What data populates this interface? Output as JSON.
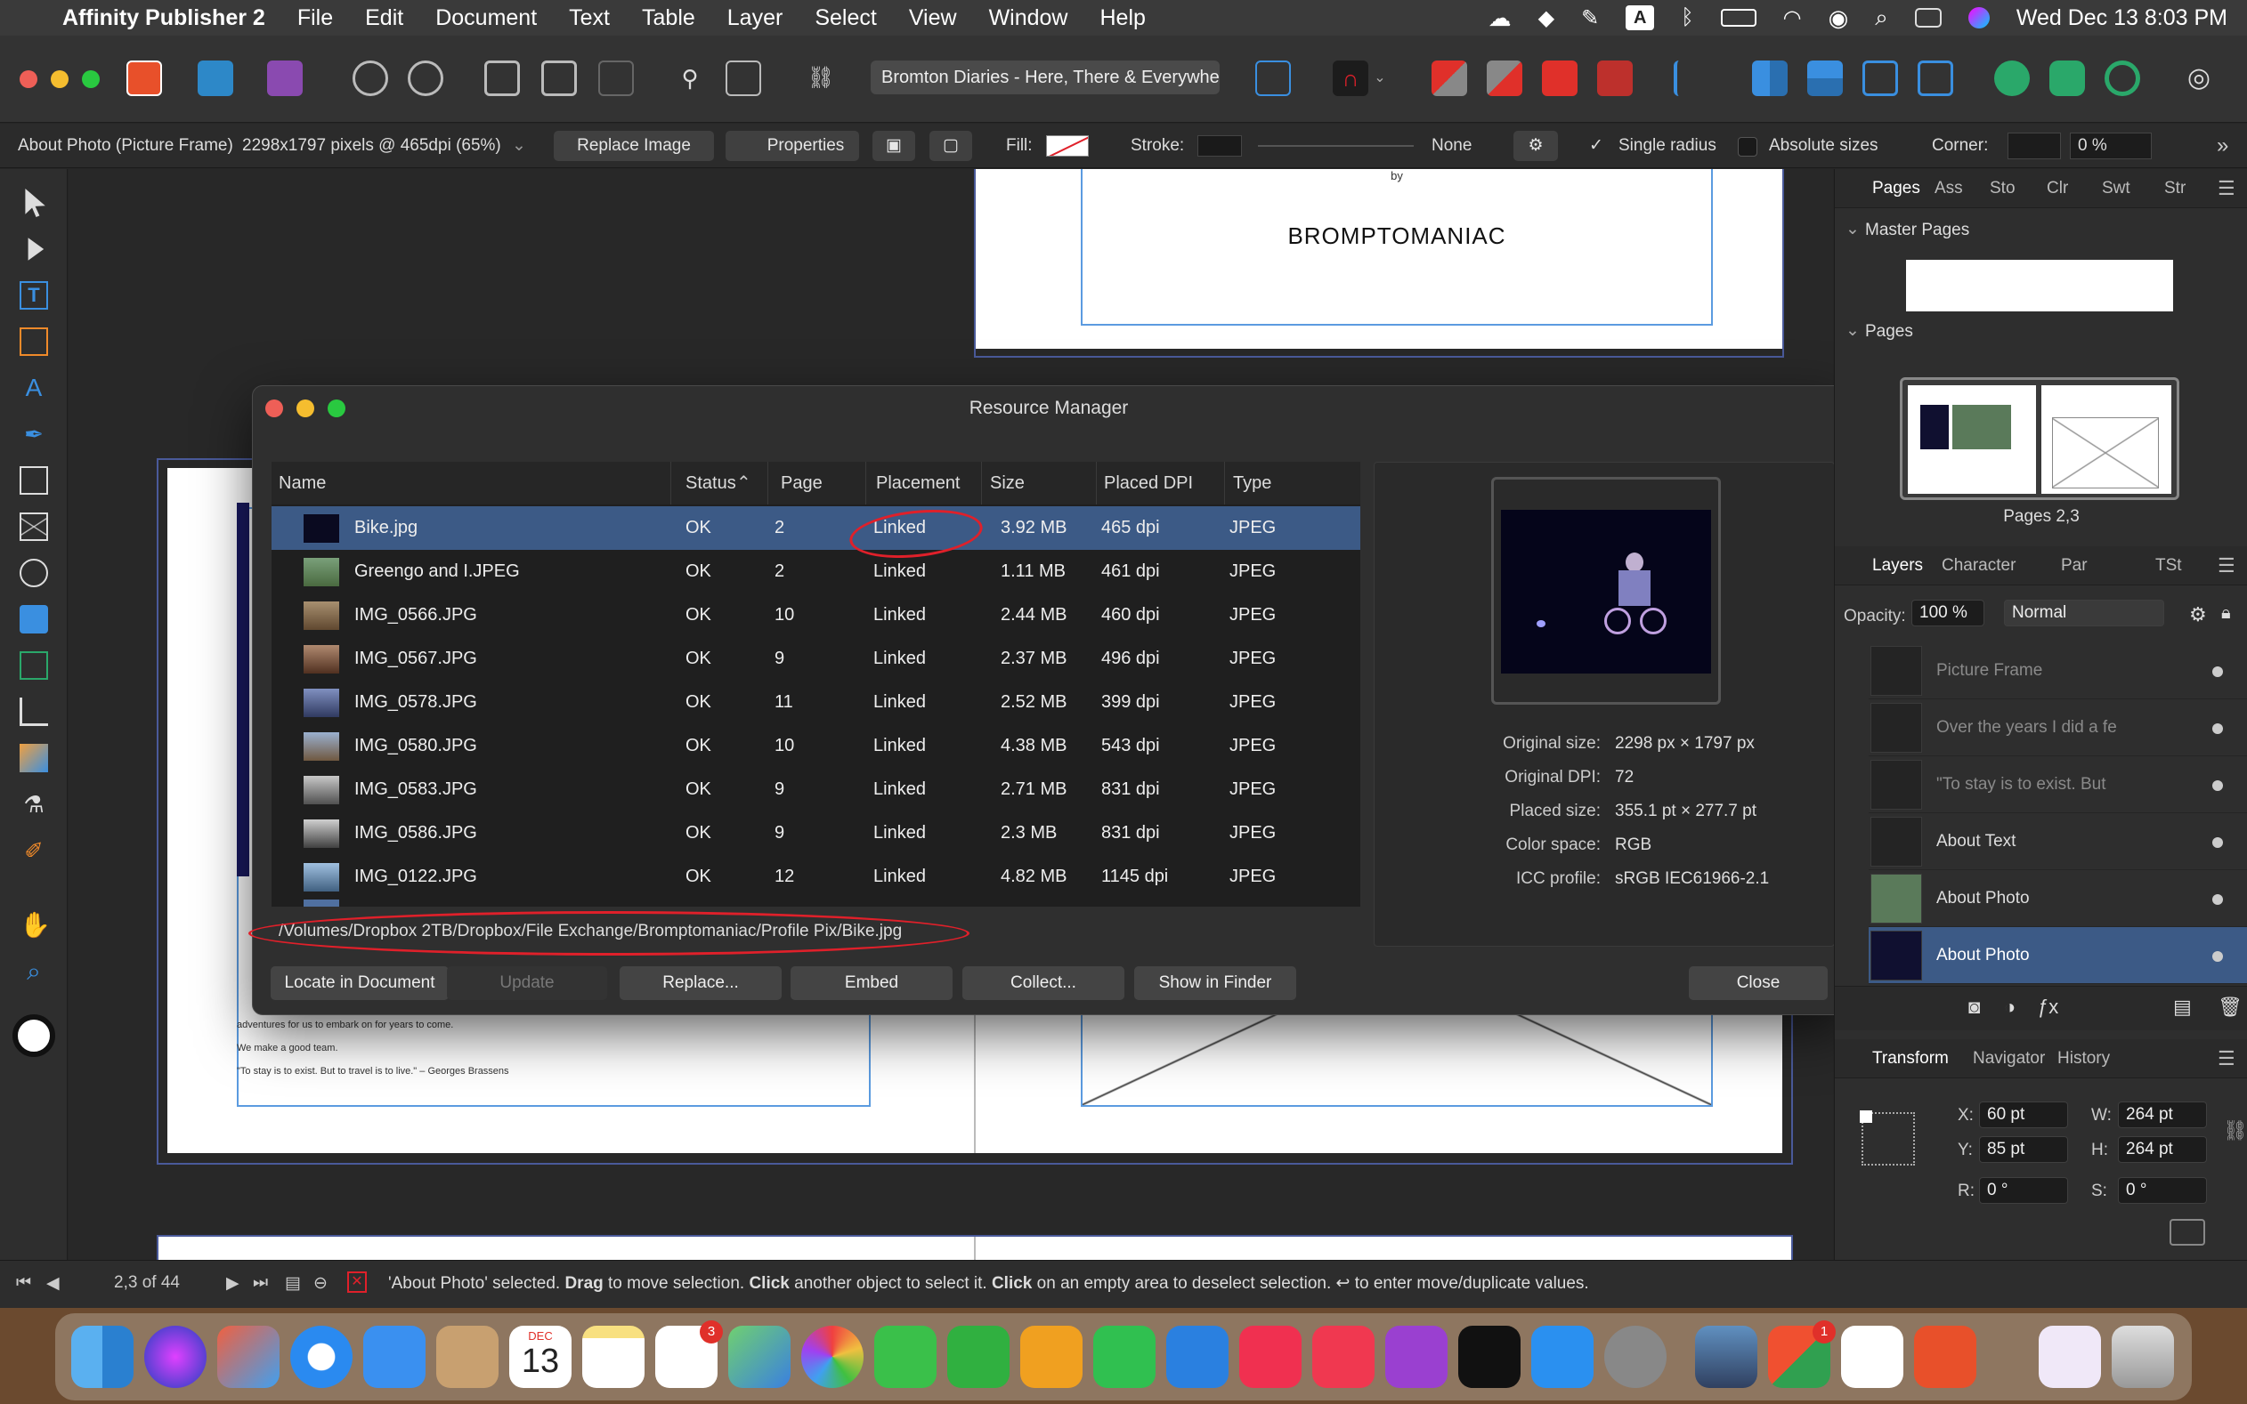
{
  "menubar": {
    "app_name": "Affinity Publisher 2",
    "items": [
      "File",
      "Edit",
      "Document",
      "Text",
      "Table",
      "Layer",
      "Select",
      "View",
      "Window",
      "Help"
    ],
    "clock": "Wed Dec 13  8:03 PM"
  },
  "toolbar": {
    "document_title": "Bromton Diaries - Here, There & Everywhere"
  },
  "context_bar": {
    "selection_label": "About Photo (Picture Frame)",
    "image_info": "2298x1797 pixels @ 465dpi (65%)",
    "replace_image": "Replace Image",
    "properties": "Properties",
    "fill_label": "Fill:",
    "stroke_label": "Stroke:",
    "stroke_value": "None",
    "single_radius": "Single radius",
    "absolute_sizes": "Absolute sizes",
    "corner_label": "Corner:",
    "corner_value": "0 %"
  },
  "canvas": {
    "by_text": "by",
    "logo_text": "BROMPTOMANIAC",
    "body_line_1": "adventures for us to embark on for years to come.",
    "body_line_2": "We make a good team.",
    "body_line_3": "\"To stay is to exist. But to travel is to live.\" – Georges Brassens"
  },
  "resource_manager": {
    "title": "Resource Manager",
    "columns": [
      "Name",
      "Status",
      "Page",
      "Placement",
      "Size",
      "Placed DPI",
      "Type"
    ],
    "rows": [
      {
        "name": "Bike.jpg",
        "status": "OK",
        "page": "2",
        "placement": "Linked",
        "size": "3.92 MB",
        "dpi": "465 dpi",
        "type": "JPEG"
      },
      {
        "name": "Greengo and I.JPEG",
        "status": "OK",
        "page": "2",
        "placement": "Linked",
        "size": "1.11 MB",
        "dpi": "461 dpi",
        "type": "JPEG"
      },
      {
        "name": "IMG_0566.JPG",
        "status": "OK",
        "page": "10",
        "placement": "Linked",
        "size": "2.44 MB",
        "dpi": "460 dpi",
        "type": "JPEG"
      },
      {
        "name": "IMG_0567.JPG",
        "status": "OK",
        "page": "9",
        "placement": "Linked",
        "size": "2.37 MB",
        "dpi": "496 dpi",
        "type": "JPEG"
      },
      {
        "name": "IMG_0578.JPG",
        "status": "OK",
        "page": "11",
        "placement": "Linked",
        "size": "2.52 MB",
        "dpi": "399 dpi",
        "type": "JPEG"
      },
      {
        "name": "IMG_0580.JPG",
        "status": "OK",
        "page": "10",
        "placement": "Linked",
        "size": "4.38 MB",
        "dpi": "543 dpi",
        "type": "JPEG"
      },
      {
        "name": "IMG_0583.JPG",
        "status": "OK",
        "page": "9",
        "placement": "Linked",
        "size": "2.71 MB",
        "dpi": "831 dpi",
        "type": "JPEG"
      },
      {
        "name": "IMG_0586.JPG",
        "status": "OK",
        "page": "9",
        "placement": "Linked",
        "size": "2.3 MB",
        "dpi": "831 dpi",
        "type": "JPEG"
      },
      {
        "name": "IMG_0122.JPG",
        "status": "OK",
        "page": "12",
        "placement": "Linked",
        "size": "4.82 MB",
        "dpi": "1145 dpi",
        "type": "JPEG"
      }
    ],
    "path": "/Volumes/Dropbox 2TB/Dropbox/File Exchange/Bromptomaniac/Profile Pix/Bike.jpg",
    "buttons": {
      "locate": "Locate in Document",
      "update": "Update",
      "replace": "Replace...",
      "embed": "Embed",
      "collect": "Collect...",
      "show_in_finder": "Show in Finder",
      "close": "Close"
    },
    "info": {
      "original_size_label": "Original size:",
      "original_size": "2298 px × 1797 px",
      "original_dpi_label": "Original DPI:",
      "original_dpi": "72",
      "placed_size_label": "Placed size:",
      "placed_size": "355.1 pt × 277.7 pt",
      "color_space_label": "Color space:",
      "color_space": "RGB",
      "icc_label": "ICC profile:",
      "icc": "sRGB IEC61966-2.1"
    }
  },
  "right_panel": {
    "top_tabs": [
      "Pages",
      "Ass",
      "Sto",
      "Clr",
      "Swt",
      "Str"
    ],
    "master_pages": "Master Pages",
    "pages": "Pages",
    "spread_label": "Pages 2,3",
    "layer_tabs": [
      "Layers",
      "Character",
      "Par",
      "TSt"
    ],
    "opacity_label": "Opacity:",
    "opacity_value": "100 %",
    "blend_mode": "Normal",
    "layers": [
      {
        "name": "Picture Frame"
      },
      {
        "name": "Over the years I did a fe"
      },
      {
        "name": "\"To stay is to exist. But"
      },
      {
        "name": "About Text"
      },
      {
        "name": "About Photo"
      },
      {
        "name": "About Photo"
      }
    ],
    "bottom_tabs": [
      "Transform",
      "Navigator",
      "History"
    ],
    "transform": {
      "x_label": "X:",
      "x": "60 pt",
      "y_label": "Y:",
      "y": "85 pt",
      "w_label": "W:",
      "w": "264 pt",
      "h_label": "H:",
      "h": "264 pt",
      "r_label": "R:",
      "r": "0 °",
      "s_label": "S:",
      "s": "0 °"
    }
  },
  "status_bar": {
    "page_indicator": "2,3 of 44",
    "msg_1": "'About Photo' selected. ",
    "msg_drag": "Drag",
    "msg_2": " to move selection. ",
    "msg_click1": "Click",
    "msg_3": " another object to select it. ",
    "msg_click2": "Click",
    "msg_4": " on an empty area to deselect selection. ↩ to enter move/duplicate values."
  },
  "dock": {
    "calendar_month": "DEC",
    "calendar_day": "13",
    "reminders_badge": "3",
    "office_badge": "1"
  },
  "colors": {
    "selection_blue": "#3c5a86",
    "annotation_red": "#e0202a",
    "affinity_orange": "#e8502a"
  }
}
